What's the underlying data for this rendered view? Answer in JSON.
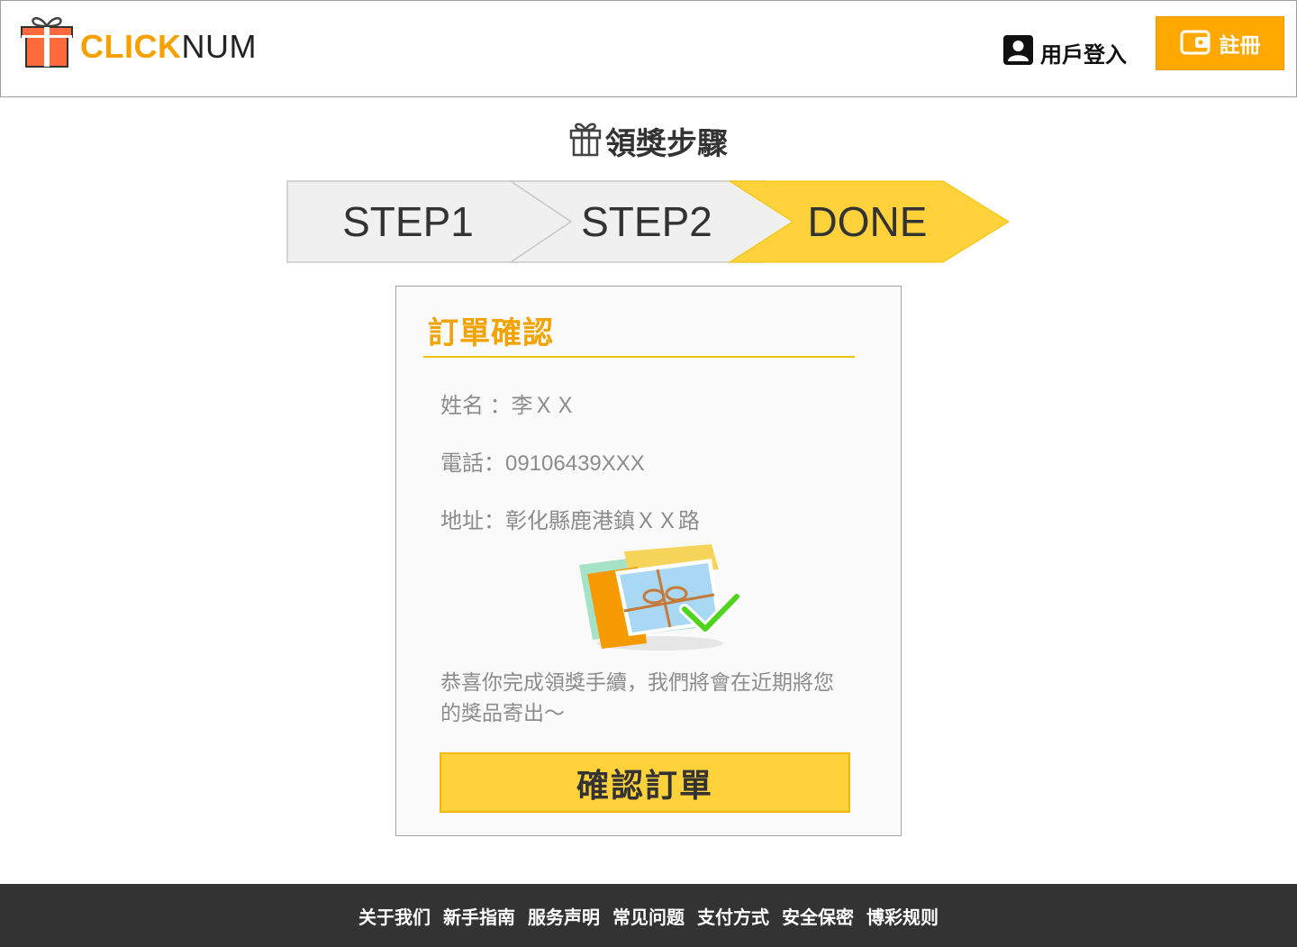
{
  "header": {
    "logo_highlight": "CLICK",
    "logo_rest": "NUM",
    "login_label": "用戶登入",
    "register_label": "註冊"
  },
  "steps": {
    "title": "領獎步驟",
    "items": [
      {
        "label": "STEP1",
        "active": false
      },
      {
        "label": "STEP2",
        "active": false
      },
      {
        "label": "DONE",
        "active": true
      }
    ]
  },
  "order": {
    "title": "訂單確認",
    "name_row": "姓名 ：李ＸＸ",
    "phone_row": "電話：09106439XXX",
    "address_row": "地址：彰化縣鹿港鎮ＸＸ路",
    "message": "恭喜你完成領獎手續，我們將會在近期將您的獎品寄出～",
    "confirm_label": "確認訂單"
  },
  "footer": {
    "links": [
      "关于我们",
      "新手指南",
      "服务声明",
      "常见问题",
      "支付方式",
      "安全保密",
      "博彩规则"
    ]
  },
  "colors": {
    "accent": "#ffa800",
    "step_active": "#ffd23c",
    "step_inactive": "#f0f0f0",
    "footer_bg": "#333333"
  },
  "icons": {
    "logo": "gift-box-icon",
    "login": "user-icon",
    "register": "wallet-icon",
    "steps_title": "gift-icon",
    "illustration": "gift-card-check-icon"
  }
}
